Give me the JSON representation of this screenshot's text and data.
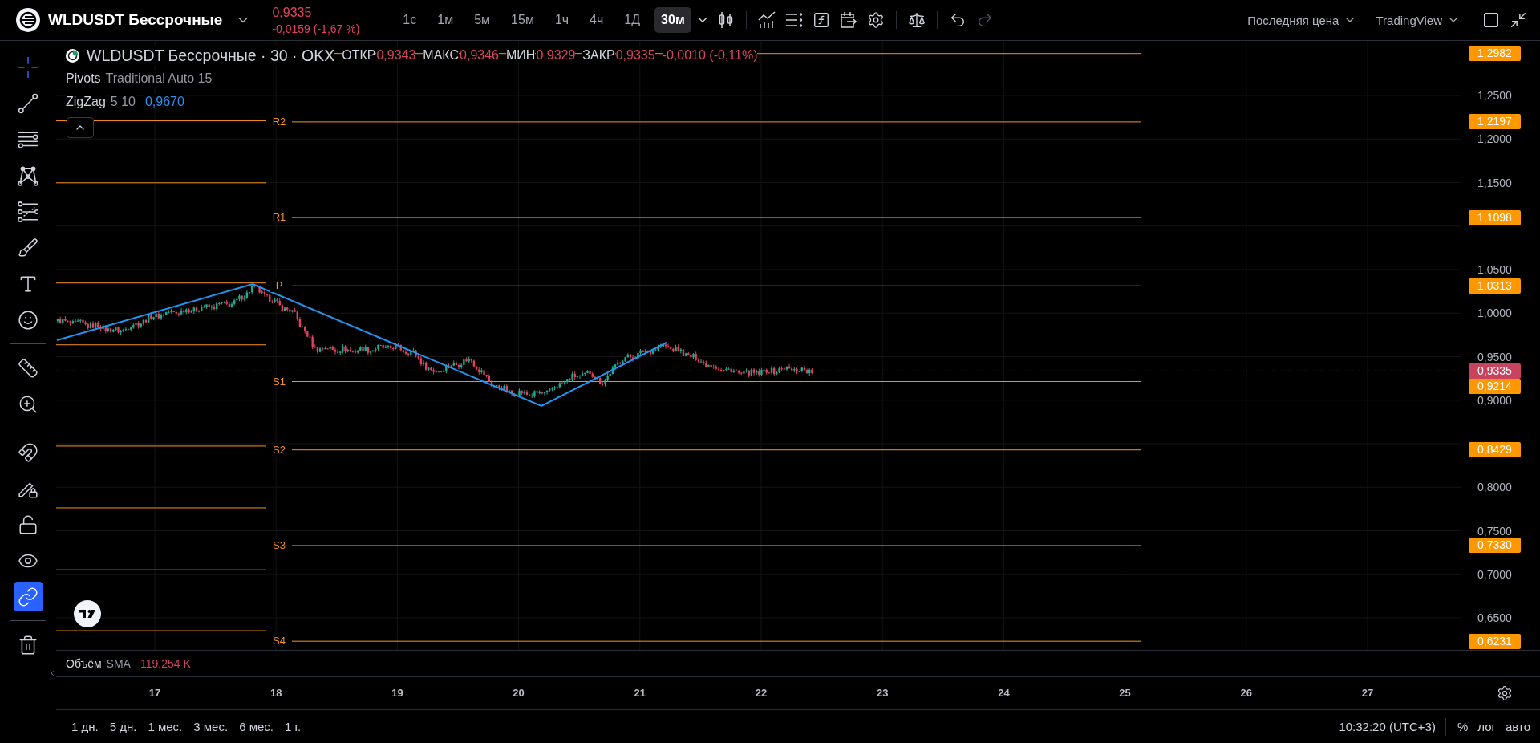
{
  "header": {
    "symbol": "WLDUSDT Бессрочные",
    "price": "0,9335",
    "change": "-0,0159 (-1,67 %)"
  },
  "intervals": [
    {
      "label": "1с",
      "selected": false
    },
    {
      "label": "1м",
      "selected": false
    },
    {
      "label": "5м",
      "selected": false
    },
    {
      "label": "15м",
      "selected": false
    },
    {
      "label": "1ч",
      "selected": false
    },
    {
      "label": "4ч",
      "selected": false
    },
    {
      "label": "1Д",
      "selected": false
    },
    {
      "label": "30м",
      "selected": true
    }
  ],
  "history": [
    {
      "disabled": false
    },
    {
      "disabled": true
    }
  ],
  "menus": [
    "Последняя цена",
    "TradingView"
  ],
  "drawing_tools": [
    {
      "selected": true
    },
    {
      "selected": false
    },
    {
      "selected": false
    },
    {
      "selected": false
    },
    {
      "selected": false
    },
    {
      "selected": false
    },
    {
      "selected": false
    },
    {
      "selected": false
    }
  ],
  "measure_tools": [
    {
      "selected": false
    },
    {
      "selected": false
    }
  ],
  "toggles": [
    {
      "on": false
    },
    {
      "on": false
    },
    {
      "on": false
    },
    {
      "on": false
    },
    {
      "on": true
    }
  ],
  "legend": {
    "title": "WLDUSDT Бессрочные · 30 · OKX",
    "ohlc": [
      {
        "label": "ОТКР",
        "value": "0,9343"
      },
      {
        "label": "МАКС",
        "value": "0,9346"
      },
      {
        "label": "МИН",
        "value": "0,9329"
      },
      {
        "label": "ЗАКР",
        "value": "0,9335"
      }
    ],
    "change": "-0,0010 (-0,11%)",
    "indicators": [
      {
        "name": "Pivots",
        "params": "Traditional Auto 15"
      },
      {
        "name": "ZigZag",
        "params": "5 10",
        "value": "0,9670"
      }
    ]
  },
  "pivots": [
    {
      "badge": "1,2982"
    },
    {
      "label": "R2",
      "badge": "1,2197"
    },
    {
      "label": "R1",
      "badge": "1,1098"
    },
    {
      "label": "P",
      "badge": "1,0313"
    },
    {
      "label": "S1",
      "badge": "0,9214"
    },
    {
      "label": "S2",
      "badge": "0,8429"
    },
    {
      "label": "S3",
      "badge": "0,7330"
    },
    {
      "label": "S4",
      "badge": "0,6231"
    }
  ],
  "price_axis": {
    "ticks": [
      "1,2500",
      "1,2000",
      "1,1500",
      "1,0500",
      "1,0000",
      "0,9500",
      "0,9000",
      "0,8000",
      "0,7500",
      "0,7000",
      "0,6500"
    ],
    "current_price": "0,9335"
  },
  "volume_pane": {
    "title": "Объём",
    "params": "SMA",
    "value": "119,254 K"
  },
  "time_axis": [
    "17",
    "18",
    "19",
    "20",
    "21",
    "22",
    "23",
    "24",
    "25",
    "26",
    "27"
  ],
  "bottom_bar": {
    "ranges": [
      "1 дн.",
      "5 дн.",
      "1 мес.",
      "3 мес.",
      "6 мес.",
      "1 г."
    ],
    "clock": "10:32:20 (UTC+3)",
    "scale_options": [
      "%",
      "лог",
      "авто"
    ]
  }
}
